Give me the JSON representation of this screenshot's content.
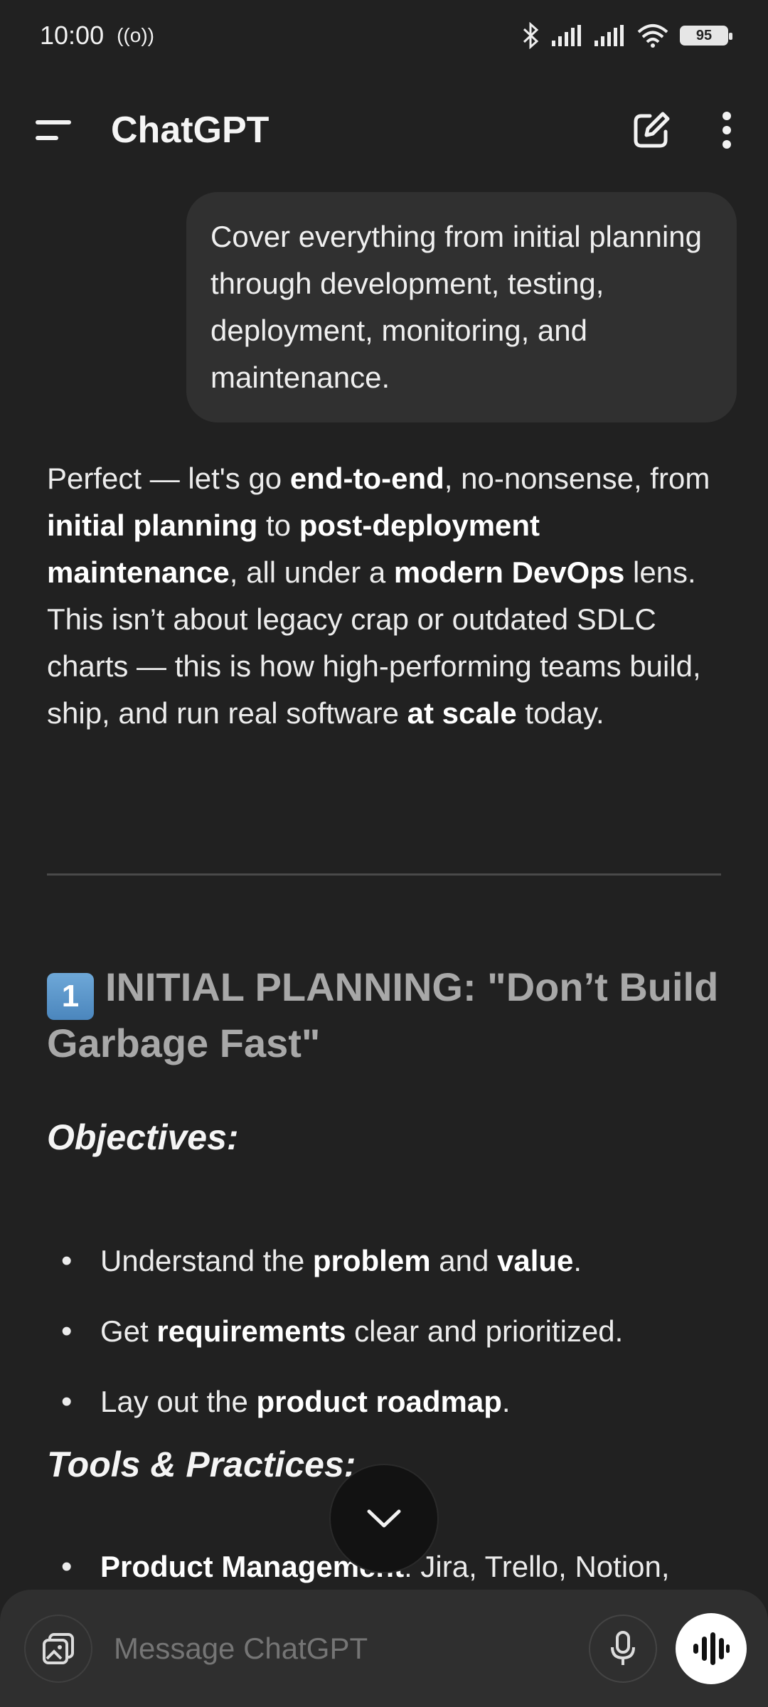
{
  "status_bar": {
    "time": "10:00",
    "radio_icon": "((o))",
    "battery": "95"
  },
  "header": {
    "title": "ChatGPT",
    "menu_icon": "menu-icon",
    "new_chat_icon": "edit-icon",
    "more_icon": "more-vertical-icon"
  },
  "conversation": {
    "user_message": "Cover everything from initial planning through development, testing, deployment, monitoring, and maintenance.",
    "assistant": {
      "intro": [
        {
          "t": "Perfect — let's go "
        },
        {
          "t": "end-to-end",
          "b": true
        },
        {
          "t": ", no-nonsense, from "
        },
        {
          "t": "initial planning",
          "b": true
        },
        {
          "t": " to "
        },
        {
          "t": "post-deployment maintenance",
          "b": true
        },
        {
          "t": ", all under a "
        },
        {
          "t": "modern DevOps",
          "b": true
        },
        {
          "t": " lens. This isn’t about legacy crap or outdated SDLC charts — this is how high-performing teams build, ship, and run real software "
        },
        {
          "t": "at scale",
          "b": true
        },
        {
          "t": " today."
        }
      ],
      "section_number": "1",
      "section_title": "INITIAL PLANNING: \"Don’t Build Garbage Fast\"",
      "objectives_heading": "Objectives:",
      "objectives": [
        [
          {
            "t": "Understand the "
          },
          {
            "t": "problem",
            "b": true
          },
          {
            "t": " and "
          },
          {
            "t": "value",
            "b": true
          },
          {
            "t": "."
          }
        ],
        [
          {
            "t": "Get "
          },
          {
            "t": "requirements",
            "b": true
          },
          {
            "t": " clear and prioritized."
          }
        ],
        [
          {
            "t": "Lay out the "
          },
          {
            "t": "product roadmap",
            "b": true
          },
          {
            "t": "."
          }
        ]
      ],
      "tools_heading": "Tools & Practices:",
      "tools": [
        [
          {
            "t": "Product Management",
            "b": true
          },
          {
            "t": ": Jira, Trello, Notion,"
          }
        ]
      ]
    }
  },
  "composer": {
    "placeholder": "Message ChatGPT"
  }
}
